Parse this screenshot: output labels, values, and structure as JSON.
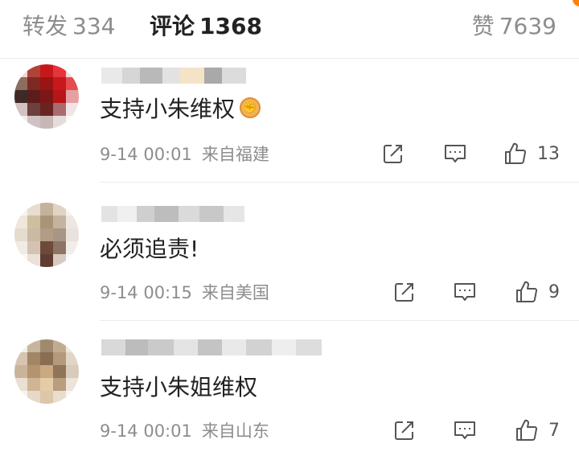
{
  "tabs": {
    "repost": {
      "label": "转发",
      "count": "334"
    },
    "comments": {
      "label": "评论",
      "count": "1368"
    },
    "likes": {
      "label": "赞",
      "count": "7639"
    }
  },
  "comments": [
    {
      "text": "支持小朱维权",
      "emoji": "fist-emoji",
      "time": "9-14 00:01",
      "location": "来自福建",
      "likes": "13"
    },
    {
      "text": "必须追责!",
      "time": "9-14 00:15",
      "location": "来自美国",
      "likes": "9"
    },
    {
      "text": "支持小朱姐维权",
      "time": "9-14 00:01",
      "location": "来自山东",
      "likes": "7"
    }
  ],
  "colors": {
    "accent": "#ff8200",
    "primary_text": "#222222",
    "secondary_text": "#8d8d8d",
    "divider": "#ececec"
  },
  "icons": [
    "repost-icon",
    "comment-icon",
    "thumbs-up-icon"
  ]
}
